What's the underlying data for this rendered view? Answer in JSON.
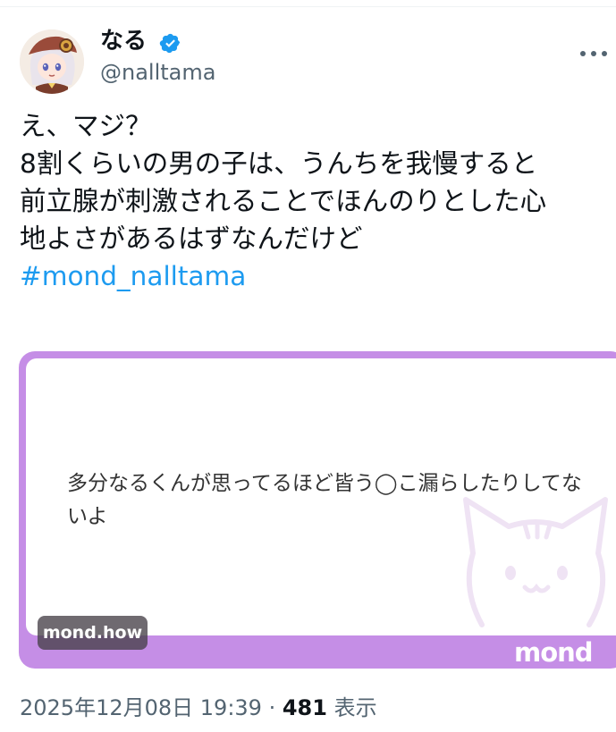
{
  "author": {
    "display_name": "なる",
    "handle": "@nalltama"
  },
  "tweet": {
    "lines": [
      "え、マジ？",
      "8割くらいの男の子は、うんちを我慢すると",
      "前立腺が刺激されることでほんのりとした心",
      "地よさがあるはずなんだけど"
    ],
    "hashtag": "#mond_nalltama"
  },
  "card": {
    "text": "多分なるくんが思ってるほど皆う◯こ漏らしたりしてないよ",
    "domain": "mond.how",
    "brand": "mond"
  },
  "meta": {
    "timestamp": "2025年12月08日 19:39",
    "separator": " · ",
    "views_count": "481",
    "views_label": " 表示"
  },
  "colors": {
    "accent": "#1d9bf0",
    "card_border": "#c58ee6",
    "muted_text": "#536471"
  },
  "icons": {
    "verified": "verified-badge-icon",
    "more": "more-options-icon",
    "watermark": "cat-face-icon"
  }
}
